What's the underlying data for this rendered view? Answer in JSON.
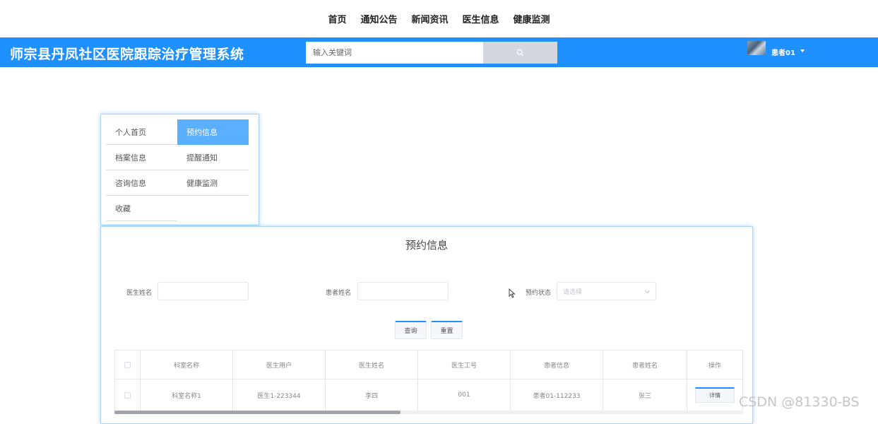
{
  "top_nav": [
    "首页",
    "通知公告",
    "新闻资讯",
    "医生信息",
    "健康监测"
  ],
  "header": {
    "site_title": "师宗县丹凤社区医院跟踪治疗管理系统",
    "search_placeholder": "输入关键词",
    "user_name": "患者01",
    "brand_color": "#1e90ff"
  },
  "side_menu": {
    "items": [
      "个人首页",
      "预约信息",
      "档案信息",
      "提醒通知",
      "咨询信息",
      "健康监测",
      "收藏"
    ],
    "active": "预约信息"
  },
  "main": {
    "title": "预约信息",
    "filters": {
      "doctor_name_label": "医生姓名",
      "patient_name_label": "患者姓名",
      "status_label": "预约状态",
      "status_placeholder": "请选择"
    },
    "buttons": {
      "query": "查询",
      "reset": "重置"
    },
    "table": {
      "headers": [
        "科室名称",
        "医生用户",
        "医生姓名",
        "医生工号",
        "患者信息",
        "患者姓名",
        "操作"
      ],
      "rows": [
        {
          "cells": [
            "科室名称1",
            "医生1-223344",
            "李四",
            "001",
            "患者01-112233",
            "张三"
          ],
          "action": "详情"
        }
      ]
    }
  },
  "watermark": "CSDN @81330-BS"
}
